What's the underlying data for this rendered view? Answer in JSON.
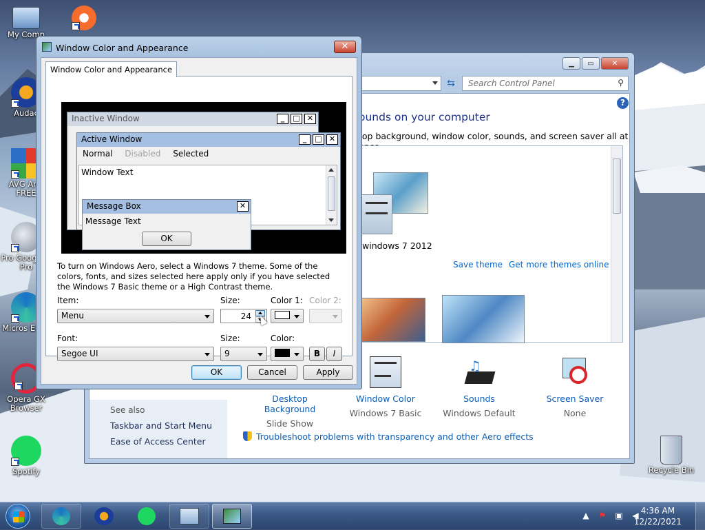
{
  "desktop": {
    "icons": [
      {
        "label": "My Comp"
      },
      {
        "label": "Audac"
      },
      {
        "label": "AVG Anti FREE"
      },
      {
        "label": "Pro Google E Pro"
      },
      {
        "label": "Micros Edge"
      },
      {
        "label": "Opera GX Browser"
      },
      {
        "label": "Spotify"
      },
      {
        "label": "Recycle Bin"
      }
    ]
  },
  "control_panel": {
    "search_placeholder": "Search Control Panel",
    "heading": "ounds on your computer",
    "subheading": "top background, window color, sounds, and screen saver all at once.",
    "theme_name": "windows 7 2012",
    "save_theme": "Save theme",
    "get_more_themes": "Get more themes online",
    "bottom_items": [
      {
        "label": "Desktop Background",
        "sub": "Slide Show"
      },
      {
        "label": "Window Color",
        "sub": "Windows 7 Basic"
      },
      {
        "label": "Sounds",
        "sub": "Windows Default"
      },
      {
        "label": "Screen Saver",
        "sub": "None"
      }
    ],
    "see_also_title": "See also",
    "see_also": [
      "Taskbar and Start Menu",
      "Ease of Access Center"
    ],
    "troubleshoot": "Troubleshoot problems with transparency and other Aero effects"
  },
  "dialog": {
    "title": "Window Color and Appearance",
    "tab": "Window Color and Appearance",
    "preview": {
      "inactive_title": "Inactive Window",
      "active_title": "Active Window",
      "menu_normal": "Normal",
      "menu_disabled": "Disabled",
      "menu_selected": "Selected",
      "window_text": "Window Text",
      "message_box_title": "Message Box",
      "message_text": "Message Text",
      "ok": "OK"
    },
    "info": "To turn on Windows Aero, select a Windows 7 theme.  Some of the colors, fonts, and sizes selected here apply only if you have selected the Windows 7 Basic theme or a High Contrast theme.",
    "item_label": "Item:",
    "item_value": "Menu",
    "size_label": "Size:",
    "size_value": "24",
    "color1_label": "Color 1:",
    "color2_label": "Color 2:",
    "font_label": "Font:",
    "font_value": "Segoe UI",
    "font_size_label": "Size:",
    "font_size_value": "9",
    "color_label": "Color:",
    "bold": "B",
    "italic": "I",
    "ok": "OK",
    "cancel": "Cancel",
    "apply": "Apply"
  },
  "taskbar": {
    "time": "4:36 AM",
    "date": "12/22/2021"
  },
  "colors": {
    "accent_link": "#0e5db4",
    "active_title": "#a5bfe2",
    "inactive_title": "#cfd8e3",
    "selected_menu": "#3399ff"
  }
}
